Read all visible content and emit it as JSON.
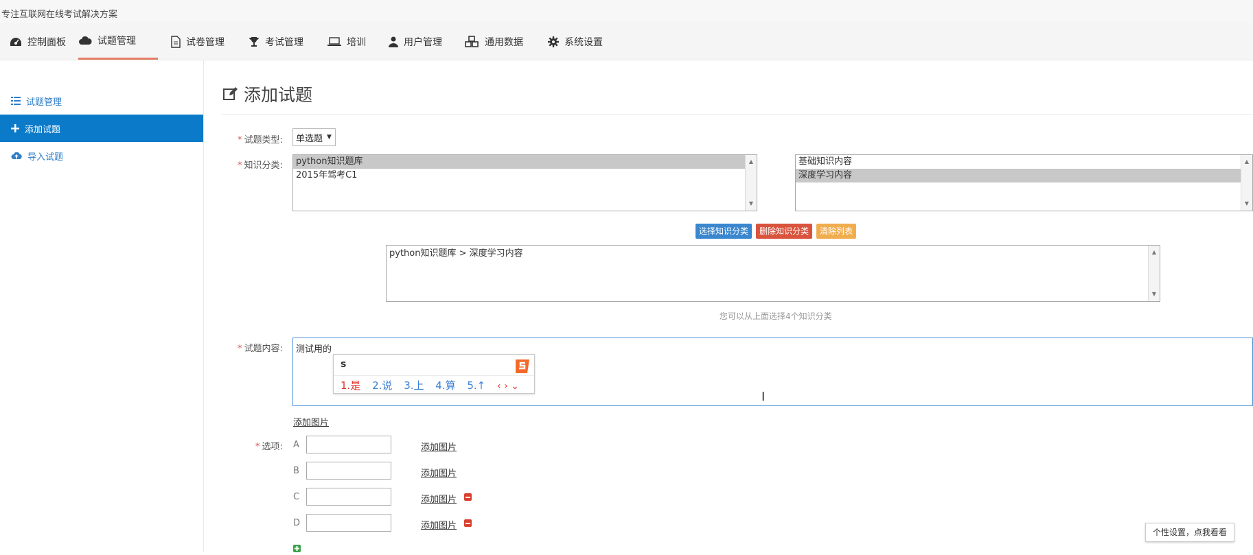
{
  "header": {
    "tagline": "专注互联网在线考试解决方案"
  },
  "nav": {
    "items": [
      {
        "label": "控制面板",
        "icon": "dashboard-icon"
      },
      {
        "label": "试题管理",
        "icon": "cloud-icon"
      },
      {
        "label": "试卷管理",
        "icon": "document-icon"
      },
      {
        "label": "考试管理",
        "icon": "trophy-icon"
      },
      {
        "label": "培训",
        "icon": "laptop-icon"
      },
      {
        "label": "用户管理",
        "icon": "user-icon"
      },
      {
        "label": "通用数据",
        "icon": "cubes-icon"
      },
      {
        "label": "系统设置",
        "icon": "gear-icon"
      }
    ],
    "active_index": 1
  },
  "sidebar": {
    "items": [
      {
        "label": "试题管理",
        "icon": "list-icon"
      },
      {
        "label": "添加试题",
        "icon": "plus-icon"
      },
      {
        "label": "导入试题",
        "icon": "cloud-upload-icon"
      }
    ],
    "active_index": 1
  },
  "page": {
    "title": "添加试题"
  },
  "form": {
    "type_label": "试题类型:",
    "type_value": "单选题",
    "category_label": "知识分类:",
    "category_list_left": [
      "python知识题库",
      "2015年驾考C1"
    ],
    "category_list_left_selected": 0,
    "category_list_right": [
      "基础知识内容",
      "深度学习内容"
    ],
    "category_list_right_selected": 1,
    "buttons": {
      "select": "选择知识分类",
      "delete": "删除知识分类",
      "clear": "清除列表"
    },
    "selected_categories": [
      "python知识题库 > 深度学习内容"
    ],
    "hint": "您可以从上面选择4个知识分类",
    "content_label": "试题内容:",
    "content_value": "测试用的",
    "add_image": "添加图片",
    "options_label": "选项:",
    "options": [
      {
        "letter": "A",
        "value": "",
        "add_image": "添加图片",
        "deletable": false
      },
      {
        "letter": "B",
        "value": "",
        "add_image": "添加图片",
        "deletable": false
      },
      {
        "letter": "C",
        "value": "",
        "add_image": "添加图片",
        "deletable": true
      },
      {
        "letter": "D",
        "value": "",
        "add_image": "添加图片",
        "deletable": true
      }
    ]
  },
  "ime": {
    "input": "s",
    "candidates": [
      "1.是",
      "2.说",
      "3.上",
      "4.算",
      "5.↑"
    ],
    "nav": "‹ › ⌄"
  },
  "tooltip": {
    "text": "个性设置，点我看看"
  },
  "colors": {
    "primary": "#0a7ac9",
    "btn_select": "#3a87cf",
    "btn_delete": "#d9533d",
    "btn_clear": "#f0ad4e",
    "active_underline": "#e57c66"
  }
}
